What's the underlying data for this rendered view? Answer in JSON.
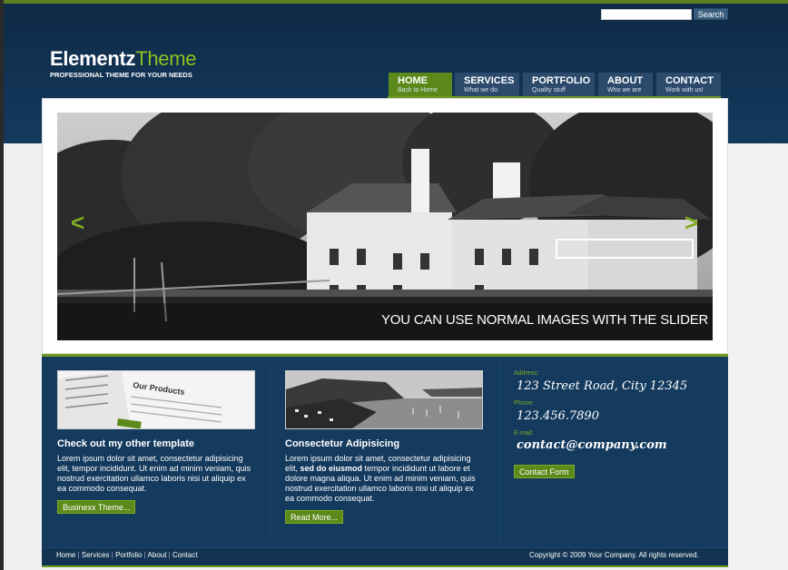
{
  "search": {
    "placeholder": "",
    "button_label": "Search"
  },
  "logo": {
    "part1": "Elementz",
    "part2": "Theme",
    "tagline": "PROFESSIONAL THEME FOR YOUR NEEDS"
  },
  "nav": [
    {
      "title": "HOME",
      "sub": "Back to Home"
    },
    {
      "title": "SERVICES",
      "sub": "What we do"
    },
    {
      "title": "PORTFOLIO",
      "sub": "Quality stuff"
    },
    {
      "title": "ABOUT",
      "sub": "Who we are"
    },
    {
      "title": "CONTACT",
      "sub": "Work with us!"
    }
  ],
  "slider": {
    "prev": "<",
    "next": ">",
    "caption": "YOU CAN USE NORMAL IMAGES WITH THE SLIDER"
  },
  "columns": [
    {
      "thumb_text": "Our Products",
      "title": "Check out my other template",
      "text": "Lorem ipsum dolor sit amet, consectetur adipisicing elit, tempor incididunt. Ut enim ad minim veniam, quis nostrud exercitation ullamco laboris nisi ut aliquip ex ea commodo consequat.",
      "button": "Businexx Theme..."
    },
    {
      "title": "Consectetur Adipisicing",
      "text_a": "Lorem ipsum dolor sit amet, consectetur adipisicing elit, ",
      "text_bold": "sed do eiusmod",
      "text_b": " tempor incididunt ut labore et dolore magna aliqua. Ut enim ad minim veniam, quis nostrud exercitation ullamco laboris nisi ut aliquip ex ea commodo consequat.",
      "button": "Read More..."
    }
  ],
  "contact": {
    "address_label": "Address:",
    "address": "123 Street Road, City 12345",
    "phone_label": "Phone:",
    "phone": "123.456.7890",
    "email_label": "E-mail:",
    "email": "contact@company.com",
    "button": "Contact Form"
  },
  "footer": {
    "links": [
      "Home",
      "Services",
      "Portfolio",
      "About",
      "Contact"
    ],
    "separator": " | ",
    "copyright": "Copyright © 2009 Your Company. All rights reserved."
  }
}
